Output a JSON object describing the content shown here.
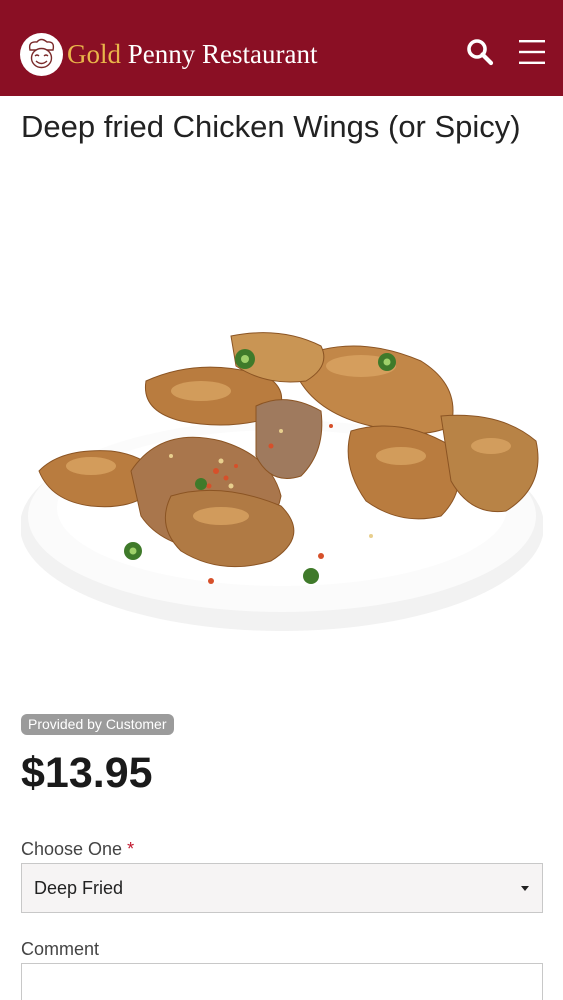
{
  "header": {
    "brand_gold": "Gold",
    "brand_rest": " Penny Restaurant",
    "logo_icon": "chef-face-logo",
    "search_icon": "search-icon",
    "menu_icon": "hamburger-menu-icon",
    "background_color": "#8a0f24",
    "gold_color": "#e9b54a"
  },
  "item": {
    "title": "Deep fried Chicken Wings (or Spicy)",
    "photo_badge": "Provided by Customer",
    "price": "$13.95"
  },
  "form": {
    "choose_label": "Choose One",
    "required_mark": "*",
    "choose_value": "Deep Fried",
    "comment_label": "Comment",
    "comment_value": ""
  }
}
